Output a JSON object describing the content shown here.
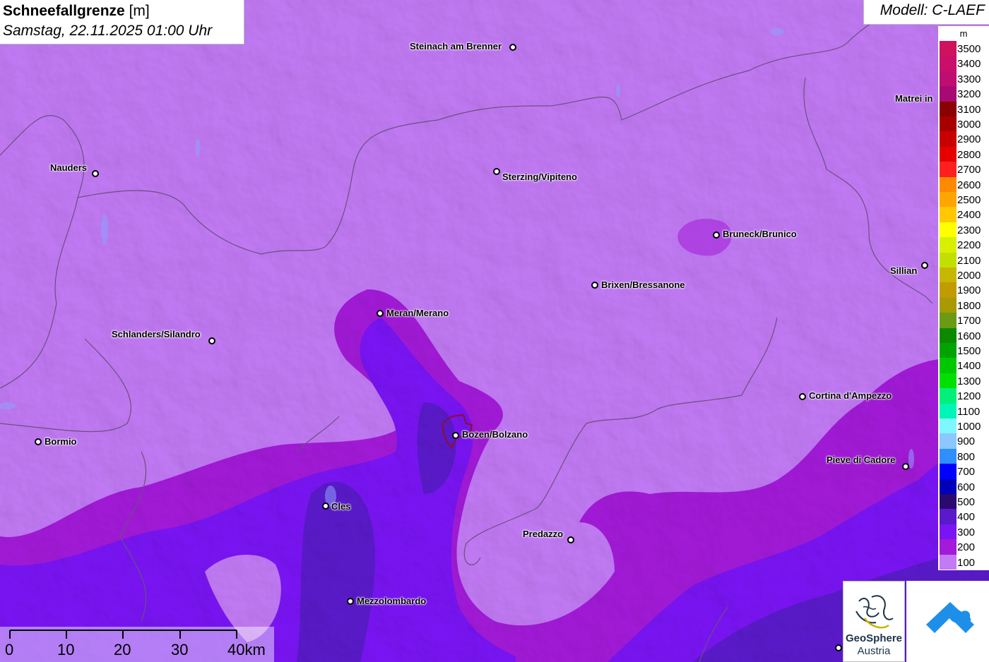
{
  "header": {
    "title_bold": "Schneefallgrenze",
    "title_unit": "[m]",
    "subtitle": "Samstag, 22.11.2025 01:00 Uhr",
    "model": "Modell: C-LAEF"
  },
  "legend": {
    "unit": "m",
    "items": [
      {
        "label": "3500",
        "color": "#d0115e"
      },
      {
        "label": "3400",
        "color": "#c90f6a"
      },
      {
        "label": "3300",
        "color": "#c00d70"
      },
      {
        "label": "3200",
        "color": "#a80a73"
      },
      {
        "label": "3100",
        "color": "#8b0000"
      },
      {
        "label": "3000",
        "color": "#a80000"
      },
      {
        "label": "2900",
        "color": "#c80000"
      },
      {
        "label": "2800",
        "color": "#e60000"
      },
      {
        "label": "2700",
        "color": "#ff1f1f"
      },
      {
        "label": "2600",
        "color": "#ff8a00"
      },
      {
        "label": "2500",
        "color": "#ffa500"
      },
      {
        "label": "2400",
        "color": "#ffc800"
      },
      {
        "label": "2300",
        "color": "#ffff00"
      },
      {
        "label": "2200",
        "color": "#d7f000"
      },
      {
        "label": "2100",
        "color": "#c2e000"
      },
      {
        "label": "2000",
        "color": "#c7b700"
      },
      {
        "label": "1900",
        "color": "#c29b00"
      },
      {
        "label": "1800",
        "color": "#a89a00"
      },
      {
        "label": "1700",
        "color": "#6b9a14"
      },
      {
        "label": "1600",
        "color": "#0b8a00"
      },
      {
        "label": "1500",
        "color": "#00a400"
      },
      {
        "label": "1400",
        "color": "#00c800"
      },
      {
        "label": "1300",
        "color": "#00e000"
      },
      {
        "label": "1200",
        "color": "#00f07a"
      },
      {
        "label": "1100",
        "color": "#00f5b8"
      },
      {
        "label": "1000",
        "color": "#7ff7ff"
      },
      {
        "label": "900",
        "color": "#8ac8ff"
      },
      {
        "label": "800",
        "color": "#2f8fff"
      },
      {
        "label": "700",
        "color": "#0000ff"
      },
      {
        "label": "600",
        "color": "#0000b8"
      },
      {
        "label": "500",
        "color": "#2a0a6e"
      },
      {
        "label": "400",
        "color": "#5a1acb"
      },
      {
        "label": "300",
        "color": "#7a14f5"
      },
      {
        "label": "200",
        "color": "#a31ad9"
      },
      {
        "label": "100",
        "color": "#c27af5"
      }
    ]
  },
  "cities": [
    {
      "name": "Steinach am Brenner"
    },
    {
      "name": "Nauders"
    },
    {
      "name": "Sterzing/Vipiteno"
    },
    {
      "name": "Matrei in"
    },
    {
      "name": "Bruneck/Brunico"
    },
    {
      "name": "Sillian"
    },
    {
      "name": "Brixen/Bressanone"
    },
    {
      "name": "Meran/Merano"
    },
    {
      "name": "Schlanders/Silandro"
    },
    {
      "name": "Cortina d'Ampezzo"
    },
    {
      "name": "Bormio"
    },
    {
      "name": "Bozen/Bolzano"
    },
    {
      "name": "Pieve di Cadore"
    },
    {
      "name": "Cles"
    },
    {
      "name": "Predazzo"
    },
    {
      "name": "Mezzolombardo"
    }
  ],
  "scale": {
    "labels": [
      "0",
      "10",
      "20",
      "30",
      "40km"
    ]
  },
  "logos": {
    "geosphere_line1": "GeoSphere",
    "geosphere_line2": "Austria"
  }
}
